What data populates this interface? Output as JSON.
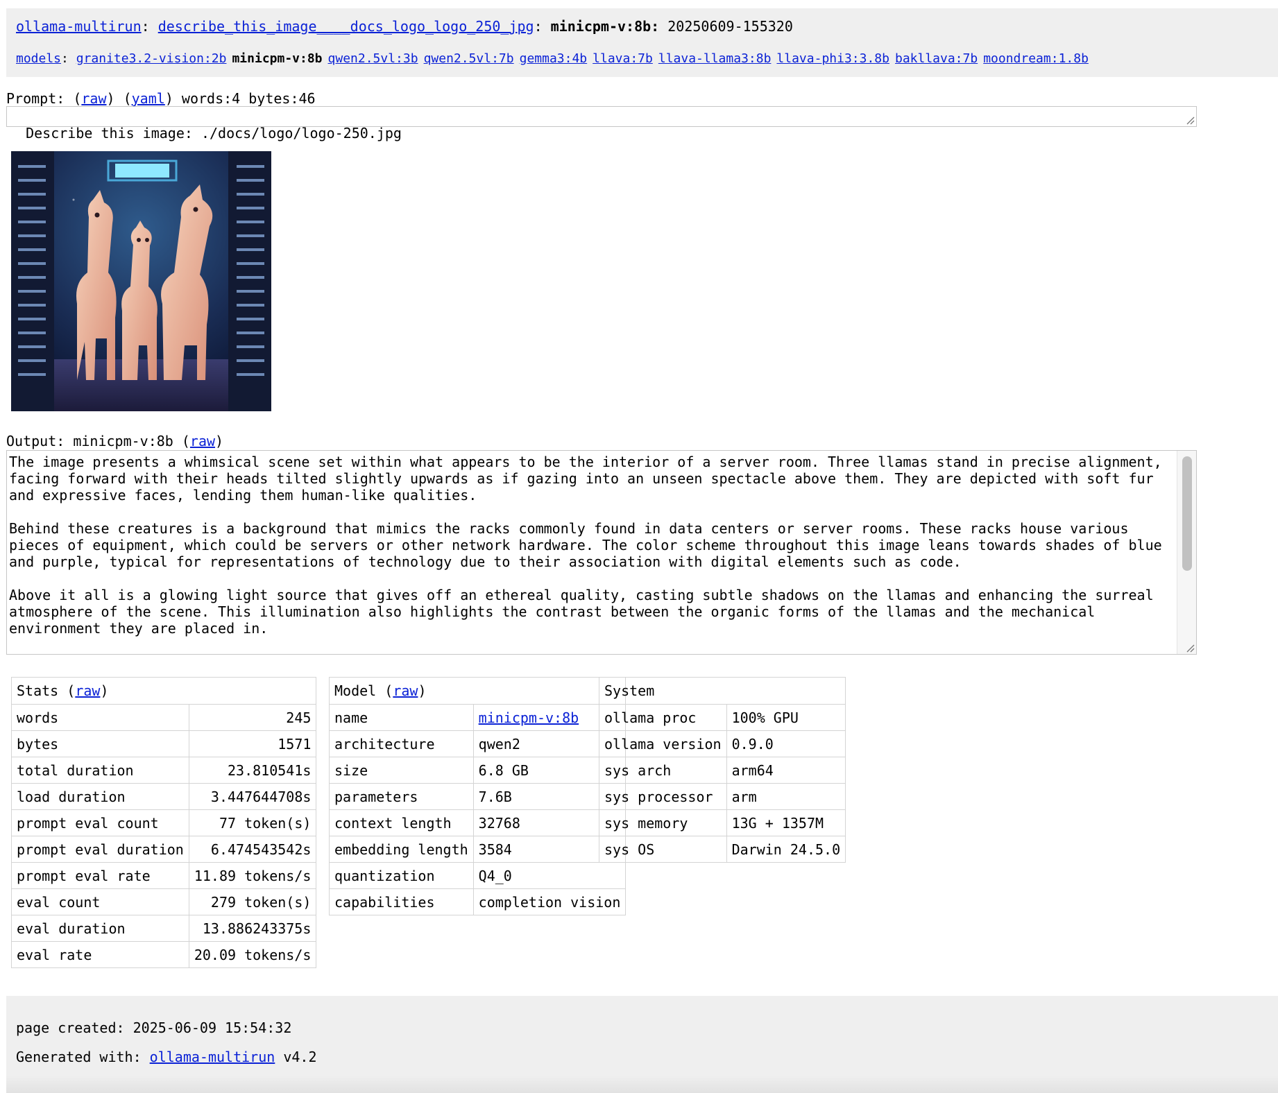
{
  "header": {
    "crumb_root": "ollama-multirun",
    "crumb_prompt": "describe_this_image____docs_logo_logo_250_jpg",
    "crumb_model": "minicpm-v:8b",
    "crumb_run": "20250609-155320",
    "sep": ":",
    "models_label": "models",
    "models": [
      {
        "label": "granite3.2-vision:2b",
        "current": false
      },
      {
        "label": "minicpm-v:8b",
        "current": true
      },
      {
        "label": "qwen2.5vl:3b",
        "current": false
      },
      {
        "label": "qwen2.5vl:7b",
        "current": false
      },
      {
        "label": "gemma3:4b",
        "current": false
      },
      {
        "label": "llava:7b",
        "current": false
      },
      {
        "label": "llava-llama3:8b",
        "current": false
      },
      {
        "label": "llava-phi3:3.8b",
        "current": false
      },
      {
        "label": "bakllava:7b",
        "current": false
      },
      {
        "label": "moondream:1.8b",
        "current": false
      }
    ]
  },
  "prompt": {
    "label": "Prompt:",
    "raw_link": "raw",
    "yaml_link": "yaml",
    "meta": "words:4 bytes:46",
    "text": "Describe this image: ./docs/logo/logo-250.jpg"
  },
  "output": {
    "label": "Output: minicpm-v:8b",
    "raw_link": "raw",
    "paragraphs": [
      "The image presents a whimsical scene set within what appears to be the interior of a server room. Three llamas stand in precise alignment,\nfacing forward with their heads tilted slightly upwards as if gazing into an unseen spectacle above them. They are depicted with soft fur\nand expressive faces, lending them human-like qualities.",
      "Behind these creatures is a background that mimics the racks commonly found in data centers or server rooms. These racks house various\npieces of equipment, which could be servers or other network hardware. The color scheme throughout this image leans towards shades of blue\nand purple, typical for representations of technology due to their association with digital elements such as code.",
      "Above it all is a glowing light source that gives off an ethereal quality, casting subtle shadows on the llamas and enhancing the surreal\natmosphere of the scene. This illumination also highlights the contrast between the organic forms of the llamas and the mechanical\nenvironment they are placed in."
    ]
  },
  "stats": {
    "title": "Stats",
    "raw_link": "raw",
    "rows": [
      {
        "k": "words",
        "v": "245"
      },
      {
        "k": "bytes",
        "v": "1571"
      },
      {
        "k": "total duration",
        "v": "23.810541s"
      },
      {
        "k": "load duration",
        "v": "3.447644708s"
      },
      {
        "k": "prompt eval count",
        "v": "77 token(s)"
      },
      {
        "k": "prompt eval duration",
        "v": "6.474543542s"
      },
      {
        "k": "prompt eval rate",
        "v": "11.89 tokens/s"
      },
      {
        "k": "eval count",
        "v": "279 token(s)"
      },
      {
        "k": "eval duration",
        "v": "13.886243375s"
      },
      {
        "k": "eval rate",
        "v": "20.09 tokens/s"
      }
    ]
  },
  "model": {
    "title": "Model",
    "raw_link": "raw",
    "name_key": "name",
    "name_value": "minicpm-v:8b",
    "rows": [
      {
        "k": "architecture",
        "v": "qwen2"
      },
      {
        "k": "size",
        "v": "6.8 GB"
      },
      {
        "k": "parameters",
        "v": "7.6B"
      },
      {
        "k": "context length",
        "v": "32768"
      },
      {
        "k": "embedding length",
        "v": "3584"
      },
      {
        "k": "quantization",
        "v": "Q4_0"
      }
    ],
    "capabilities_key": "capabilities",
    "capabilities_value": "completion\nvision"
  },
  "system": {
    "title": "System",
    "rows": [
      {
        "k": "ollama proc",
        "v": "100% GPU"
      },
      {
        "k": "ollama version",
        "v": "0.9.0"
      },
      {
        "k": "sys arch",
        "v": "arm64"
      },
      {
        "k": "sys processor",
        "v": "arm"
      },
      {
        "k": "sys memory",
        "v": "13G + 1357M"
      },
      {
        "k": "sys OS",
        "v": "Darwin 24.5.0"
      }
    ]
  },
  "footer": {
    "created": "page created: 2025-06-09 15:54:32",
    "generated_prefix": "Generated with:",
    "generated_link": "ollama-multirun",
    "version": "v4.2"
  },
  "colors": {
    "link": "#0b22d6",
    "header_bg": "#efefef"
  }
}
